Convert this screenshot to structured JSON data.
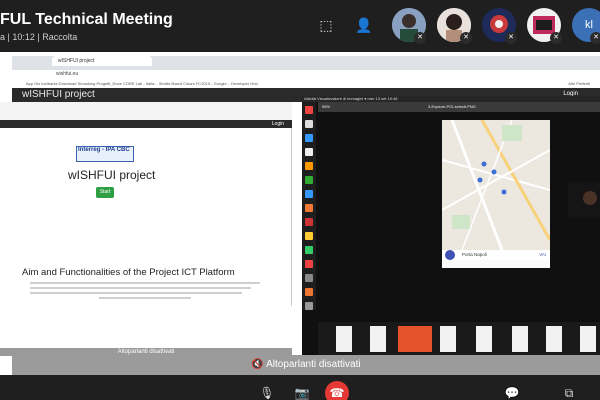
{
  "meeting": {
    "title": "FUL Technical Meeting",
    "subtitle": "a | 10:12 | Raccolta"
  },
  "browser": {
    "tab_title": "wISHFUI project",
    "address": "wishfui.eu",
    "bookmarks": "App  Gis toolbarks  Download  Smuoking  Progetti_Dove  CORE Lab - Italia...  Strutts  Board  Colors  FC2019 - Google...  Developer Hub",
    "bookmarks_more": "Altri Preferiti"
  },
  "app": {
    "nav_title": "wISHFUI project",
    "login": "Login"
  },
  "inner_page": {
    "logo_text": "Interreg - IPA CBC",
    "title": "wISHFUI project",
    "start_button": "Start",
    "section_title": "Aim and Functionalities of the Project ICT Platform",
    "login": "Login",
    "speakers_banner": "Altoparlanti disattivati"
  },
  "remote": {
    "top_bar": "Attività   Visualizzatore di immagini ▾                         mer 13 set  10:48",
    "viewer_title": "3-Explore-POI-selectl.PNG",
    "zoom": "96%",
    "map_search": "Porta Napoli",
    "map_search_btn": "VAI"
  },
  "footer": {
    "speakers_banner": "Altoparlanti disattivati"
  },
  "colors": {
    "accent_green": "#2ea043",
    "hangup_red": "#e53935",
    "thumb_selected": "#e6522c"
  }
}
